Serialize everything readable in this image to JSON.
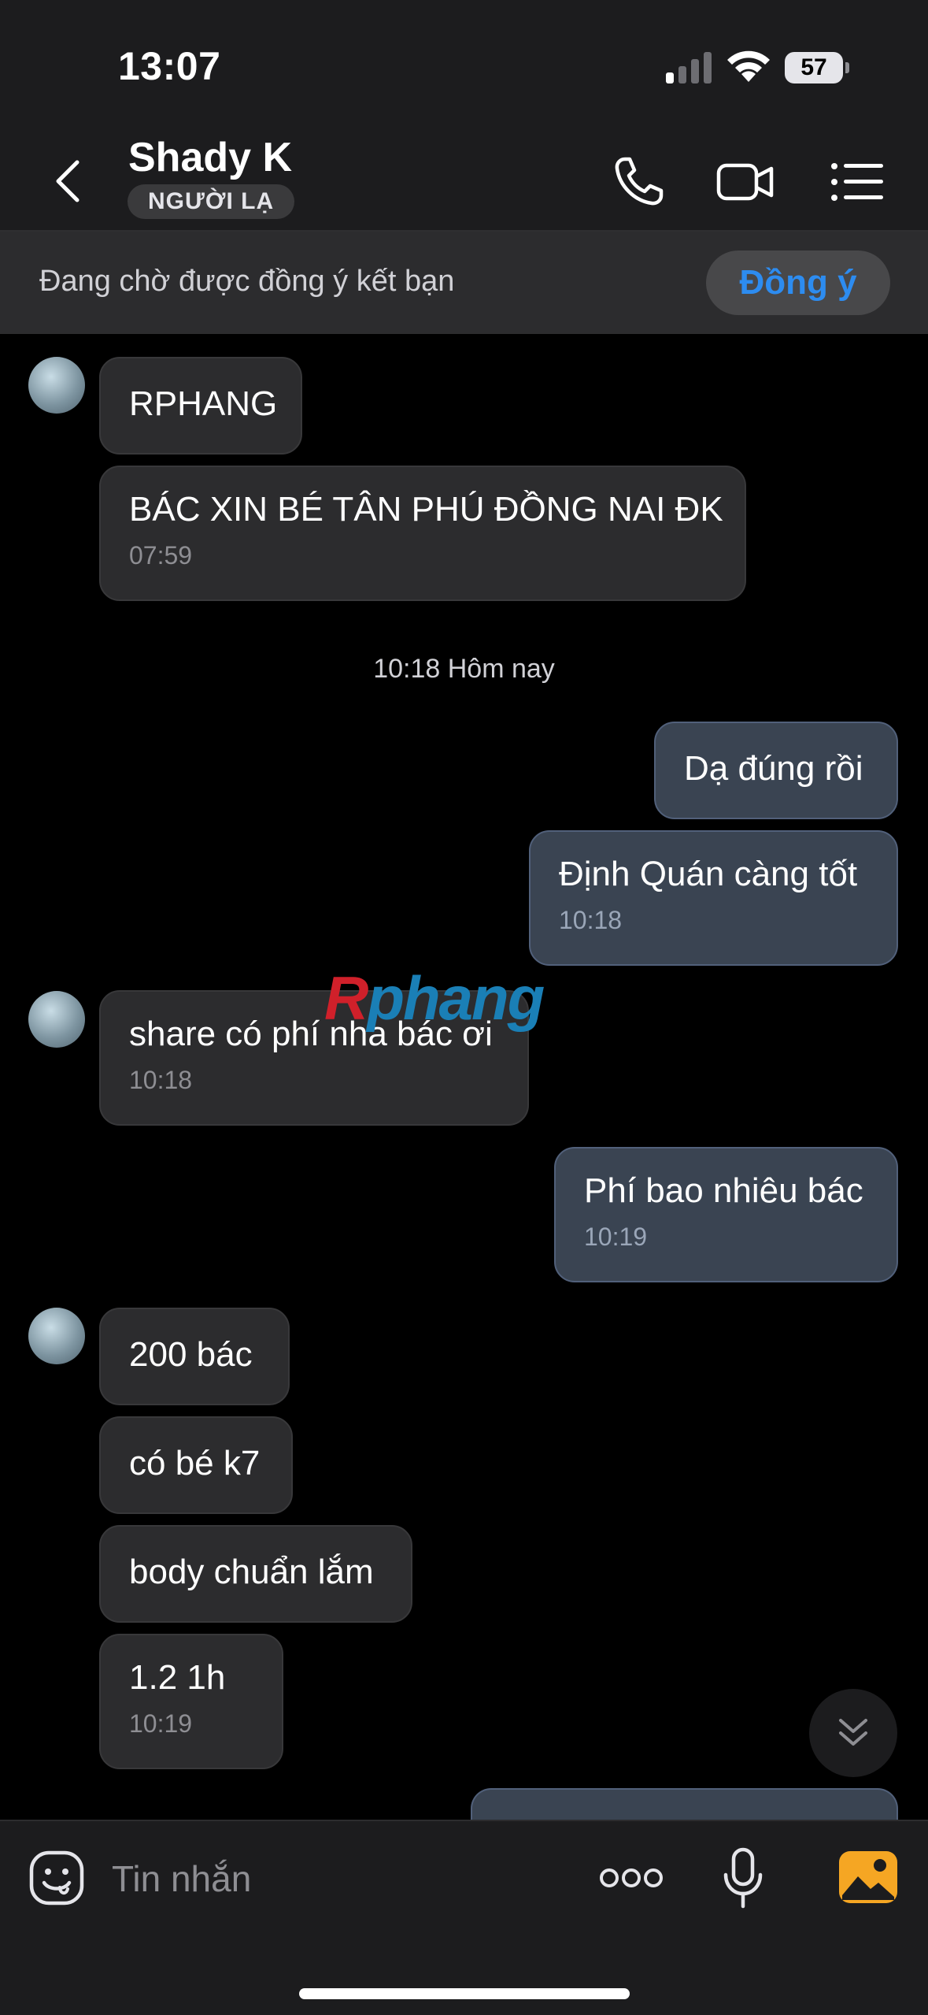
{
  "status_bar": {
    "time": "13:07",
    "battery": "57"
  },
  "header": {
    "name": "Shady K",
    "badge": "NGƯỜI LẠ",
    "icons": [
      "back-icon",
      "phone-icon",
      "video-camera-icon",
      "menu-list-icon"
    ]
  },
  "request_bar": {
    "text": "Đang chờ được đồng ý kết bạn",
    "accept_label": "Đồng ý"
  },
  "messages": [
    {
      "side": "in",
      "text": "RPHANG",
      "time": ""
    },
    {
      "side": "in",
      "text": "BÁC XIN BÉ TÂN PHÚ ĐỒNG NAI ĐK",
      "time": "07:59"
    },
    {
      "side": "out",
      "text": "Dạ đúng rồi",
      "time": ""
    },
    {
      "side": "out",
      "text": "Định Quán càng tốt",
      "time": "10:18"
    },
    {
      "side": "in",
      "text": "share có phí nha bác ơi",
      "time": "10:18"
    },
    {
      "side": "out",
      "text": "Phí bao nhiêu bác",
      "time": "10:19"
    },
    {
      "side": "in",
      "text": "200 bác",
      "time": ""
    },
    {
      "side": "in",
      "text": "có bé k7",
      "time": ""
    },
    {
      "side": "in",
      "text": "body chuẩn lắm",
      "time": ""
    },
    {
      "side": "in",
      "text": "1.2 1h",
      "time": "10:19"
    }
  ],
  "date_separator": "10:18 Hôm nay",
  "watermark": {
    "first": "R",
    "rest": "phang"
  },
  "input": {
    "placeholder": "Tin nhắn"
  },
  "colors": {
    "accent": "#2d8cf0",
    "outgoing_bubble": "#3a4452",
    "incoming_bubble": "#2c2c2e",
    "gallery": "#f5a623"
  }
}
